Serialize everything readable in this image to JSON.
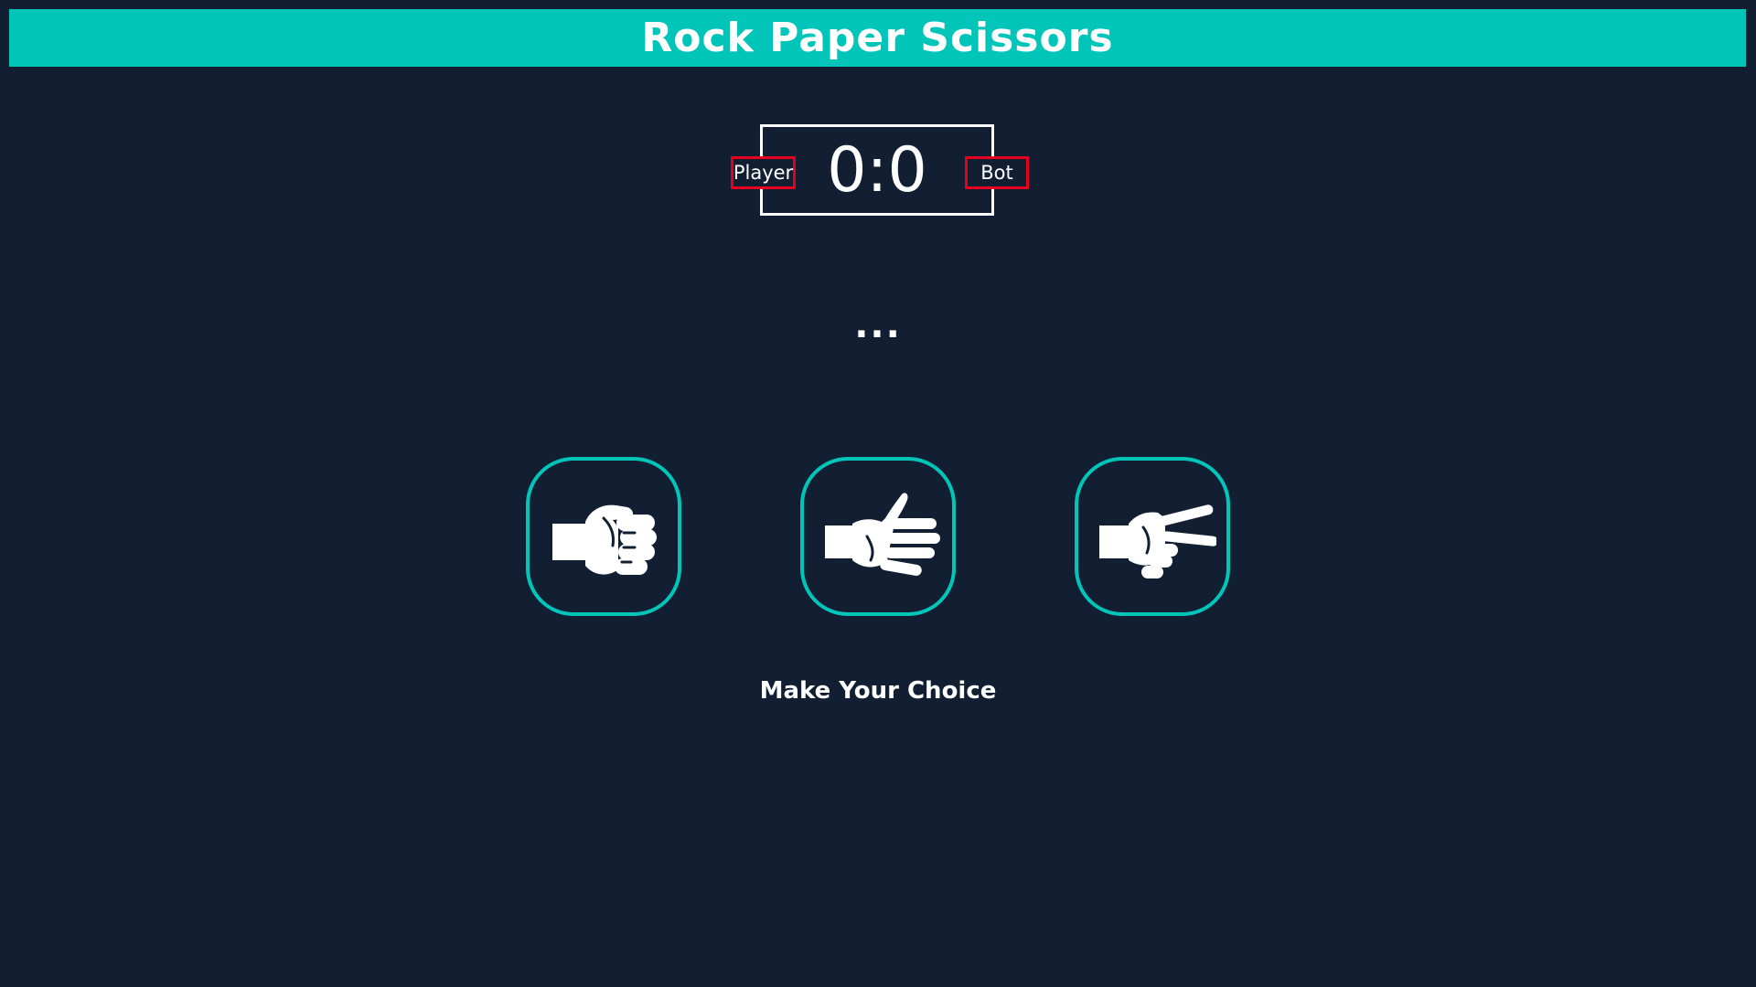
{
  "header": {
    "title": "Rock Paper Scissors"
  },
  "scoreboard": {
    "player_label": "Player",
    "bot_label": "Bot",
    "score": "0:0"
  },
  "result": {
    "text": "..."
  },
  "choices": [
    {
      "label": "rock",
      "icon": "rock-hand-icon"
    },
    {
      "label": "paper",
      "icon": "paper-hand-icon"
    },
    {
      "label": "scissors",
      "icon": "scissors-hand-icon"
    }
  ],
  "prompt": {
    "text": "Make Your Choice"
  },
  "colors": {
    "background": "#121f33",
    "accent": "#00c5b8",
    "badge_border": "#e5001e",
    "text": "#ffffff"
  }
}
